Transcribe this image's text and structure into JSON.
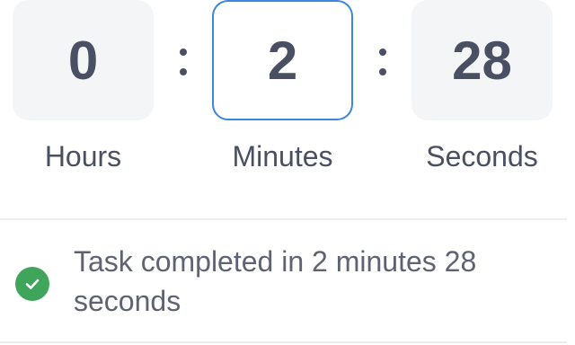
{
  "timer": {
    "hours": {
      "value": "0",
      "label": "Hours"
    },
    "minutes": {
      "value": "2",
      "label": "Minutes"
    },
    "seconds": {
      "value": "28",
      "label": "Seconds"
    },
    "separator": ":",
    "active_field": "minutes",
    "colors": {
      "active_border": "#3b86e0",
      "box_background": "#f4f5f7",
      "digit_text": "#4a5063"
    }
  },
  "status": {
    "icon": "check-circle-icon",
    "icon_color": "#3ea55a",
    "message": "Task completed in 2 minutes 28 seconds"
  }
}
